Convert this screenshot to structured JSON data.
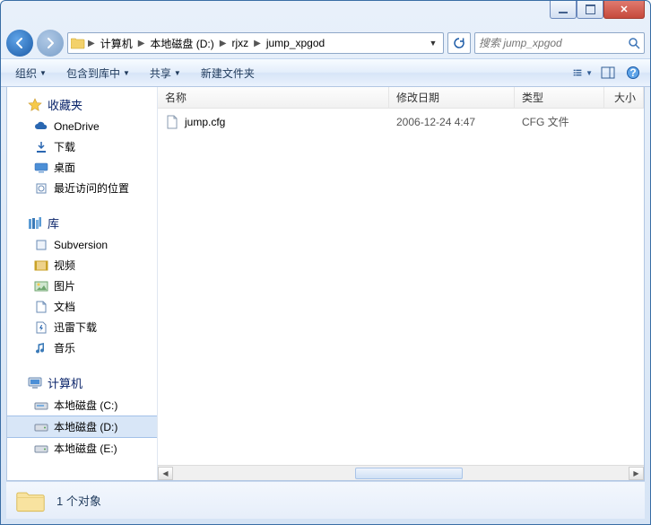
{
  "breadcrumb": {
    "segments": [
      "计算机",
      "本地磁盘 (D:)",
      "rjxz",
      "jump_xpgod"
    ]
  },
  "search": {
    "placeholder": "搜索 jump_xpgod"
  },
  "toolbar": {
    "organize": "组织",
    "include": "包含到库中",
    "share": "共享",
    "newfolder": "新建文件夹"
  },
  "sidebar": {
    "favorites": {
      "label": "收藏夹",
      "items": [
        "OneDrive",
        "下载",
        "桌面",
        "最近访问的位置"
      ]
    },
    "libraries": {
      "label": "库",
      "items": [
        "Subversion",
        "视频",
        "图片",
        "文档",
        "迅雷下载",
        "音乐"
      ]
    },
    "computer": {
      "label": "计算机",
      "items": [
        "本地磁盘 (C:)",
        "本地磁盘 (D:)",
        "本地磁盘 (E:)"
      ],
      "selected_index": 1
    }
  },
  "columns": {
    "name": "名称",
    "date": "修改日期",
    "type": "类型",
    "size": "大小"
  },
  "files": [
    {
      "name": "jump.cfg",
      "date": "2006-12-24 4:47",
      "type": "CFG 文件",
      "size": ""
    }
  ],
  "status": {
    "count_text": "1 个对象"
  },
  "icons": {
    "star": "star-icon",
    "folder": "folder-icon",
    "file": "file-icon"
  },
  "colors": {
    "accent": "#1b5aa6",
    "frame": "#d6e4f5"
  }
}
